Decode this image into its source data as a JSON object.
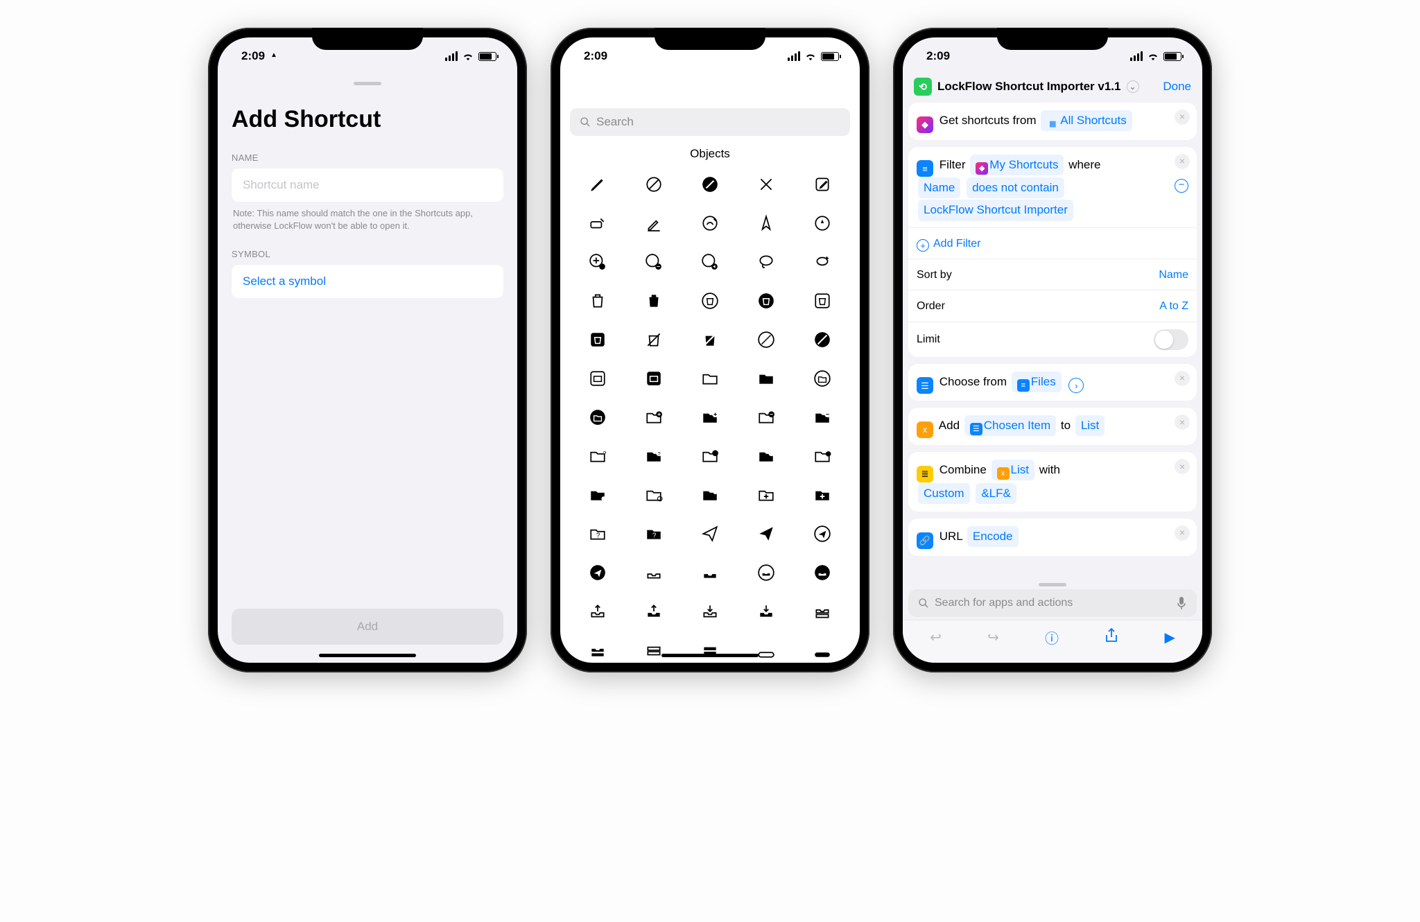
{
  "status": {
    "time": "2:09"
  },
  "screen1": {
    "title": "Add Shortcut",
    "name_label": "NAME",
    "name_placeholder": "Shortcut name",
    "note": "Note: This name should match the one in the Shortcuts app, otherwise LockFlow won't be able to open it.",
    "symbol_label": "SYMBOL",
    "select_symbol": "Select a symbol",
    "add": "Add"
  },
  "screen2": {
    "search_placeholder": "Search",
    "section": "Objects"
  },
  "screen3": {
    "title": "LockFlow Shortcut Importer v1.1",
    "done": "Done",
    "action1_pre": "Get shortcuts from",
    "action1_val": "All Shortcuts",
    "action2": {
      "filter": "Filter",
      "my": "My Shortcuts",
      "where": "where",
      "name": "Name",
      "cond": "does not contain",
      "val": "LockFlow Shortcut Importer",
      "add_filter": "Add Filter",
      "sort_by": "Sort by",
      "sort_val": "Name",
      "order": "Order",
      "order_val": "A to Z",
      "limit": "Limit"
    },
    "action3": {
      "pre": "Choose from",
      "val": "Files"
    },
    "action4": {
      "pre": "Add",
      "val": "Chosen Item",
      "mid": "to",
      "end": "List"
    },
    "action5": {
      "pre": "Combine",
      "val": "List",
      "mid": "with",
      "a": "Custom",
      "b": "&LF&"
    },
    "action6": {
      "pre": "URL",
      "val": "Encode"
    },
    "bottom_search": "Search for apps and actions"
  }
}
